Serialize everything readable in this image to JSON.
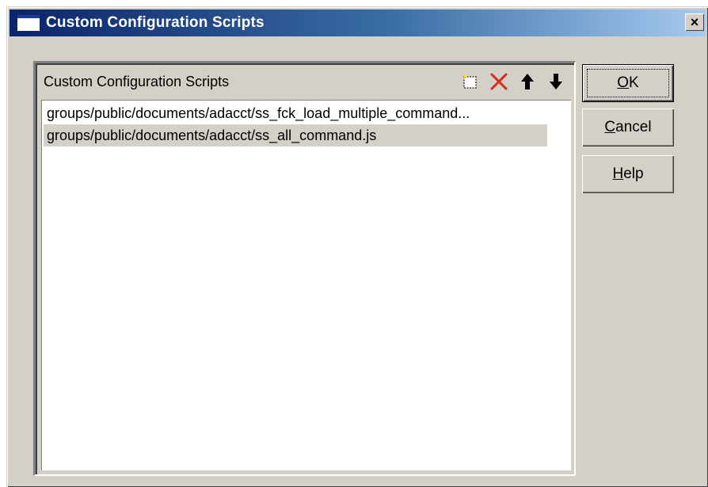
{
  "window": {
    "title": "Custom Configuration Scripts",
    "close_glyph": "×"
  },
  "panel": {
    "header_label": "Custom Configuration Scripts",
    "toolbar": [
      {
        "name": "new-script-icon",
        "color": "#e6b400"
      },
      {
        "name": "delete-icon",
        "color": "#d42c1e"
      },
      {
        "name": "move-up-icon",
        "color": "#000000"
      },
      {
        "name": "move-down-icon",
        "color": "#000000"
      }
    ],
    "items": [
      {
        "label": "groups/public/documents/adacct/ss_fck_load_multiple_command...",
        "selected": false
      },
      {
        "label": "groups/public/documents/adacct/ss_all_command.js",
        "selected": true
      }
    ]
  },
  "buttons": {
    "ok": {
      "mnemonic": "O",
      "rest": "K"
    },
    "cancel": {
      "mnemonic": "C",
      "rest": "ancel"
    },
    "help": {
      "mnemonic": "H",
      "rest": "elp"
    }
  }
}
